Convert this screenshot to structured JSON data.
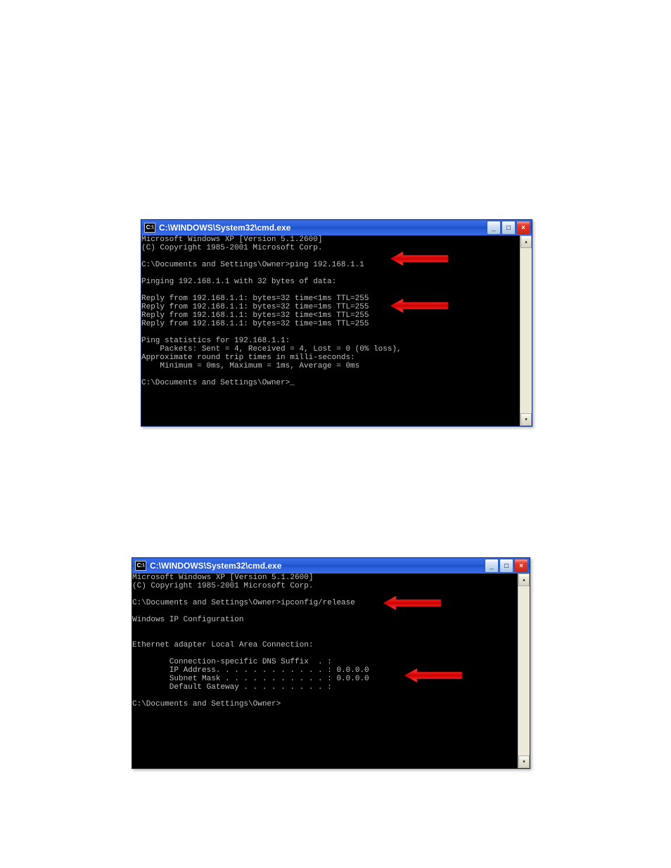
{
  "window1": {
    "title": "C:\\WINDOWS\\System32\\cmd.exe",
    "icon_glyph": "C:\\",
    "min_label": "_",
    "max_label": "□",
    "close_label": "×",
    "lines": [
      "Microsoft Windows XP [Version 5.1.2600]",
      "(C) Copyright 1985-2001 Microsoft Corp.",
      "",
      "C:\\Documents and Settings\\Owner>ping 192.168.1.1",
      "",
      "Pinging 192.168.1.1 with 32 bytes of data:",
      "",
      "Reply from 192.168.1.1: bytes=32 time<1ms TTL=255",
      "Reply from 192.168.1.1: bytes=32 time=1ms TTL=255",
      "Reply from 192.168.1.1: bytes=32 time<1ms TTL=255",
      "Reply from 192.168.1.1: bytes=32 time=1ms TTL=255",
      "",
      "Ping statistics for 192.168.1.1:",
      "    Packets: Sent = 4, Received = 4, Lost = 0 (0% loss),",
      "Approximate round trip times in milli-seconds:",
      "    Minimum = 0ms, Maximum = 1ms, Average = 0ms",
      "",
      "C:\\Documents and Settings\\Owner>_"
    ]
  },
  "window2": {
    "title": "C:\\WINDOWS\\System32\\cmd.exe",
    "icon_glyph": "C:\\",
    "min_label": "_",
    "max_label": "□",
    "close_label": "×",
    "lines": [
      "Microsoft Windows XP [Version 5.1.2600]",
      "(C) Copyright 1985-2001 Microsoft Corp.",
      "",
      "C:\\Documents and Settings\\Owner>ipconfig/release",
      "",
      "Windows IP Configuration",
      "",
      "",
      "Ethernet adapter Local Area Connection:",
      "",
      "        Connection-specific DNS Suffix  . :",
      "        IP Address. . . . . . . . . . . . : 0.0.0.0",
      "        Subnet Mask . . . . . . . . . . . : 0.0.0.0",
      "        Default Gateway . . . . . . . . . :",
      "",
      "C:\\Documents and Settings\\Owner>"
    ]
  },
  "annotations": {
    "arrow_color": "#ff0000"
  }
}
